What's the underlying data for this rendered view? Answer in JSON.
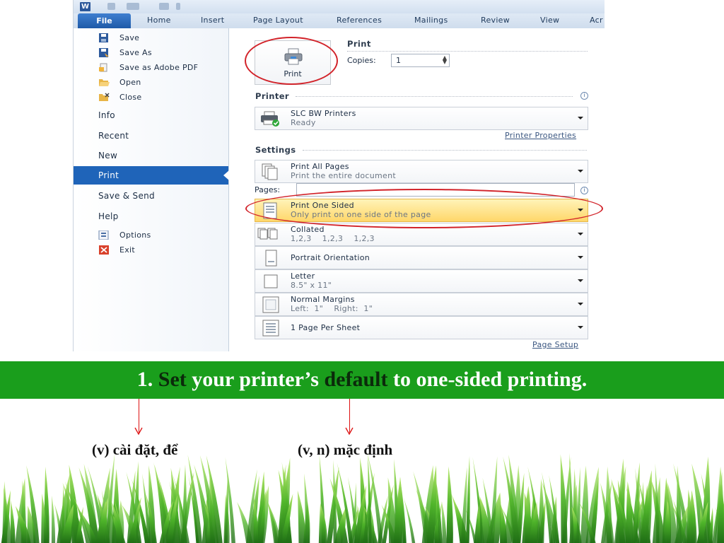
{
  "ribbon": {
    "app_logo": "W",
    "tabs": [
      "File",
      "Home",
      "Insert",
      "Page Layout",
      "References",
      "Mailings",
      "Review",
      "View",
      "Acr"
    ]
  },
  "menu": {
    "items": [
      {
        "label": "Save",
        "icon": "save-icon"
      },
      {
        "label": "Save As",
        "icon": "save-as-icon"
      },
      {
        "label": "Save as Adobe PDF",
        "icon": "adobe-pdf-icon"
      },
      {
        "label": "Open",
        "icon": "folder-open-icon"
      },
      {
        "label": "Close",
        "icon": "folder-close-icon"
      },
      {
        "label": "Info"
      },
      {
        "label": "Recent"
      },
      {
        "label": "New"
      },
      {
        "label": "Print",
        "selected": true
      },
      {
        "label": "Save & Send"
      },
      {
        "label": "Help"
      },
      {
        "label": "Options",
        "icon": "options-icon"
      },
      {
        "label": "Exit",
        "icon": "exit-icon"
      }
    ]
  },
  "print": {
    "button_label": "Print",
    "heading": "Print",
    "copies_label": "Copies:",
    "copies_value": "1"
  },
  "printer": {
    "heading": "Printer",
    "name": "SLC BW Printers",
    "status": "Ready",
    "properties_link": "Printer Properties"
  },
  "settings": {
    "heading": "Settings",
    "range": {
      "title": "Print All Pages",
      "subtitle": "Print the entire document"
    },
    "pages_label": "Pages:",
    "sided": {
      "title": "Print One Sided",
      "subtitle": "Only print on one side of the page"
    },
    "collated": {
      "title": "Collated",
      "subtitle": "1,2,3    1,2,3    1,2,3"
    },
    "orientation": {
      "title": "Portrait Orientation"
    },
    "paper": {
      "title": "Letter",
      "subtitle": "8.5\" x 11\""
    },
    "margins": {
      "title": "Normal Margins",
      "subtitle": "Left:  1\"    Right:  1\""
    },
    "per_sheet": {
      "title": "1 Page Per Sheet"
    },
    "page_setup_link": "Page Setup"
  },
  "banner": {
    "prefix": "1. ",
    "word1": "Set",
    "middle": " your printer’s ",
    "word2": "default",
    "suffix": " to one-sided printing."
  },
  "notes": {
    "set": "(v) cài đặt, để",
    "default": "(v, n) mặc định"
  },
  "colors": {
    "banner_green": "#1a9e1c",
    "highlight_ring": "#d2232a",
    "selected_menu": "#1f64b9"
  }
}
